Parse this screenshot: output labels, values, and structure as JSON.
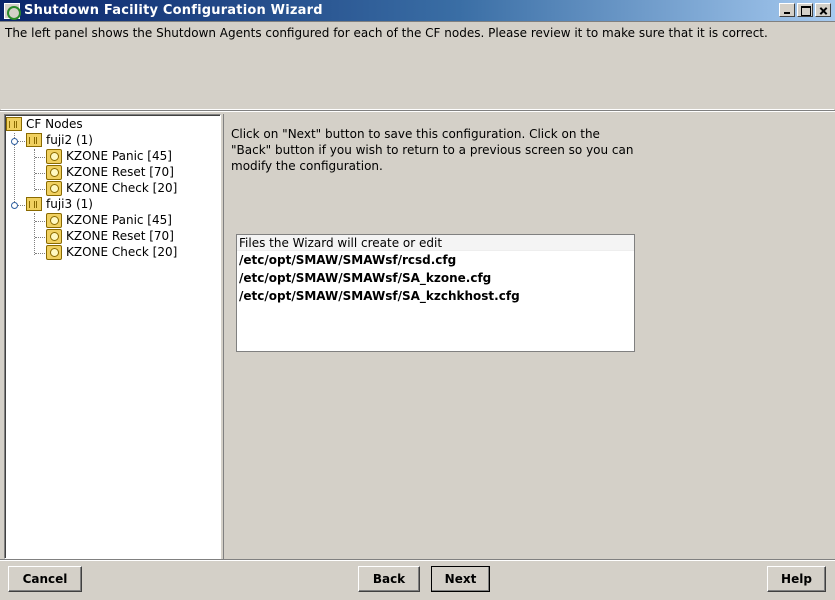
{
  "window": {
    "title": "Shutdown Facility Configuration Wizard"
  },
  "description": "The left panel shows the Shutdown Agents configured for each of the CF nodes. Please review it to make sure that it is correct.",
  "tree": {
    "root": "CF Nodes",
    "nodes": [
      {
        "label": "fuji2 (1)",
        "agents": [
          "KZONE Panic [45]",
          "KZONE Reset [70]",
          "KZONE Check [20]"
        ]
      },
      {
        "label": "fuji3 (1)",
        "agents": [
          "KZONE Panic [45]",
          "KZONE Reset [70]",
          "KZONE Check [20]"
        ]
      }
    ]
  },
  "instructions": "Click on \"Next\" button to save this configuration. Click on the \"Back\" button if you wish to return to a previous screen so you can modify the configuration.",
  "files": {
    "header": "Files the Wizard will create or edit",
    "items": [
      "/etc/opt/SMAW/SMAWsf/rcsd.cfg",
      "/etc/opt/SMAW/SMAWsf/SA_kzone.cfg",
      "/etc/opt/SMAW/SMAWsf/SA_kzchkhost.cfg"
    ]
  },
  "buttons": {
    "cancel": "Cancel",
    "back": "Back",
    "next": "Next",
    "help": "Help"
  }
}
